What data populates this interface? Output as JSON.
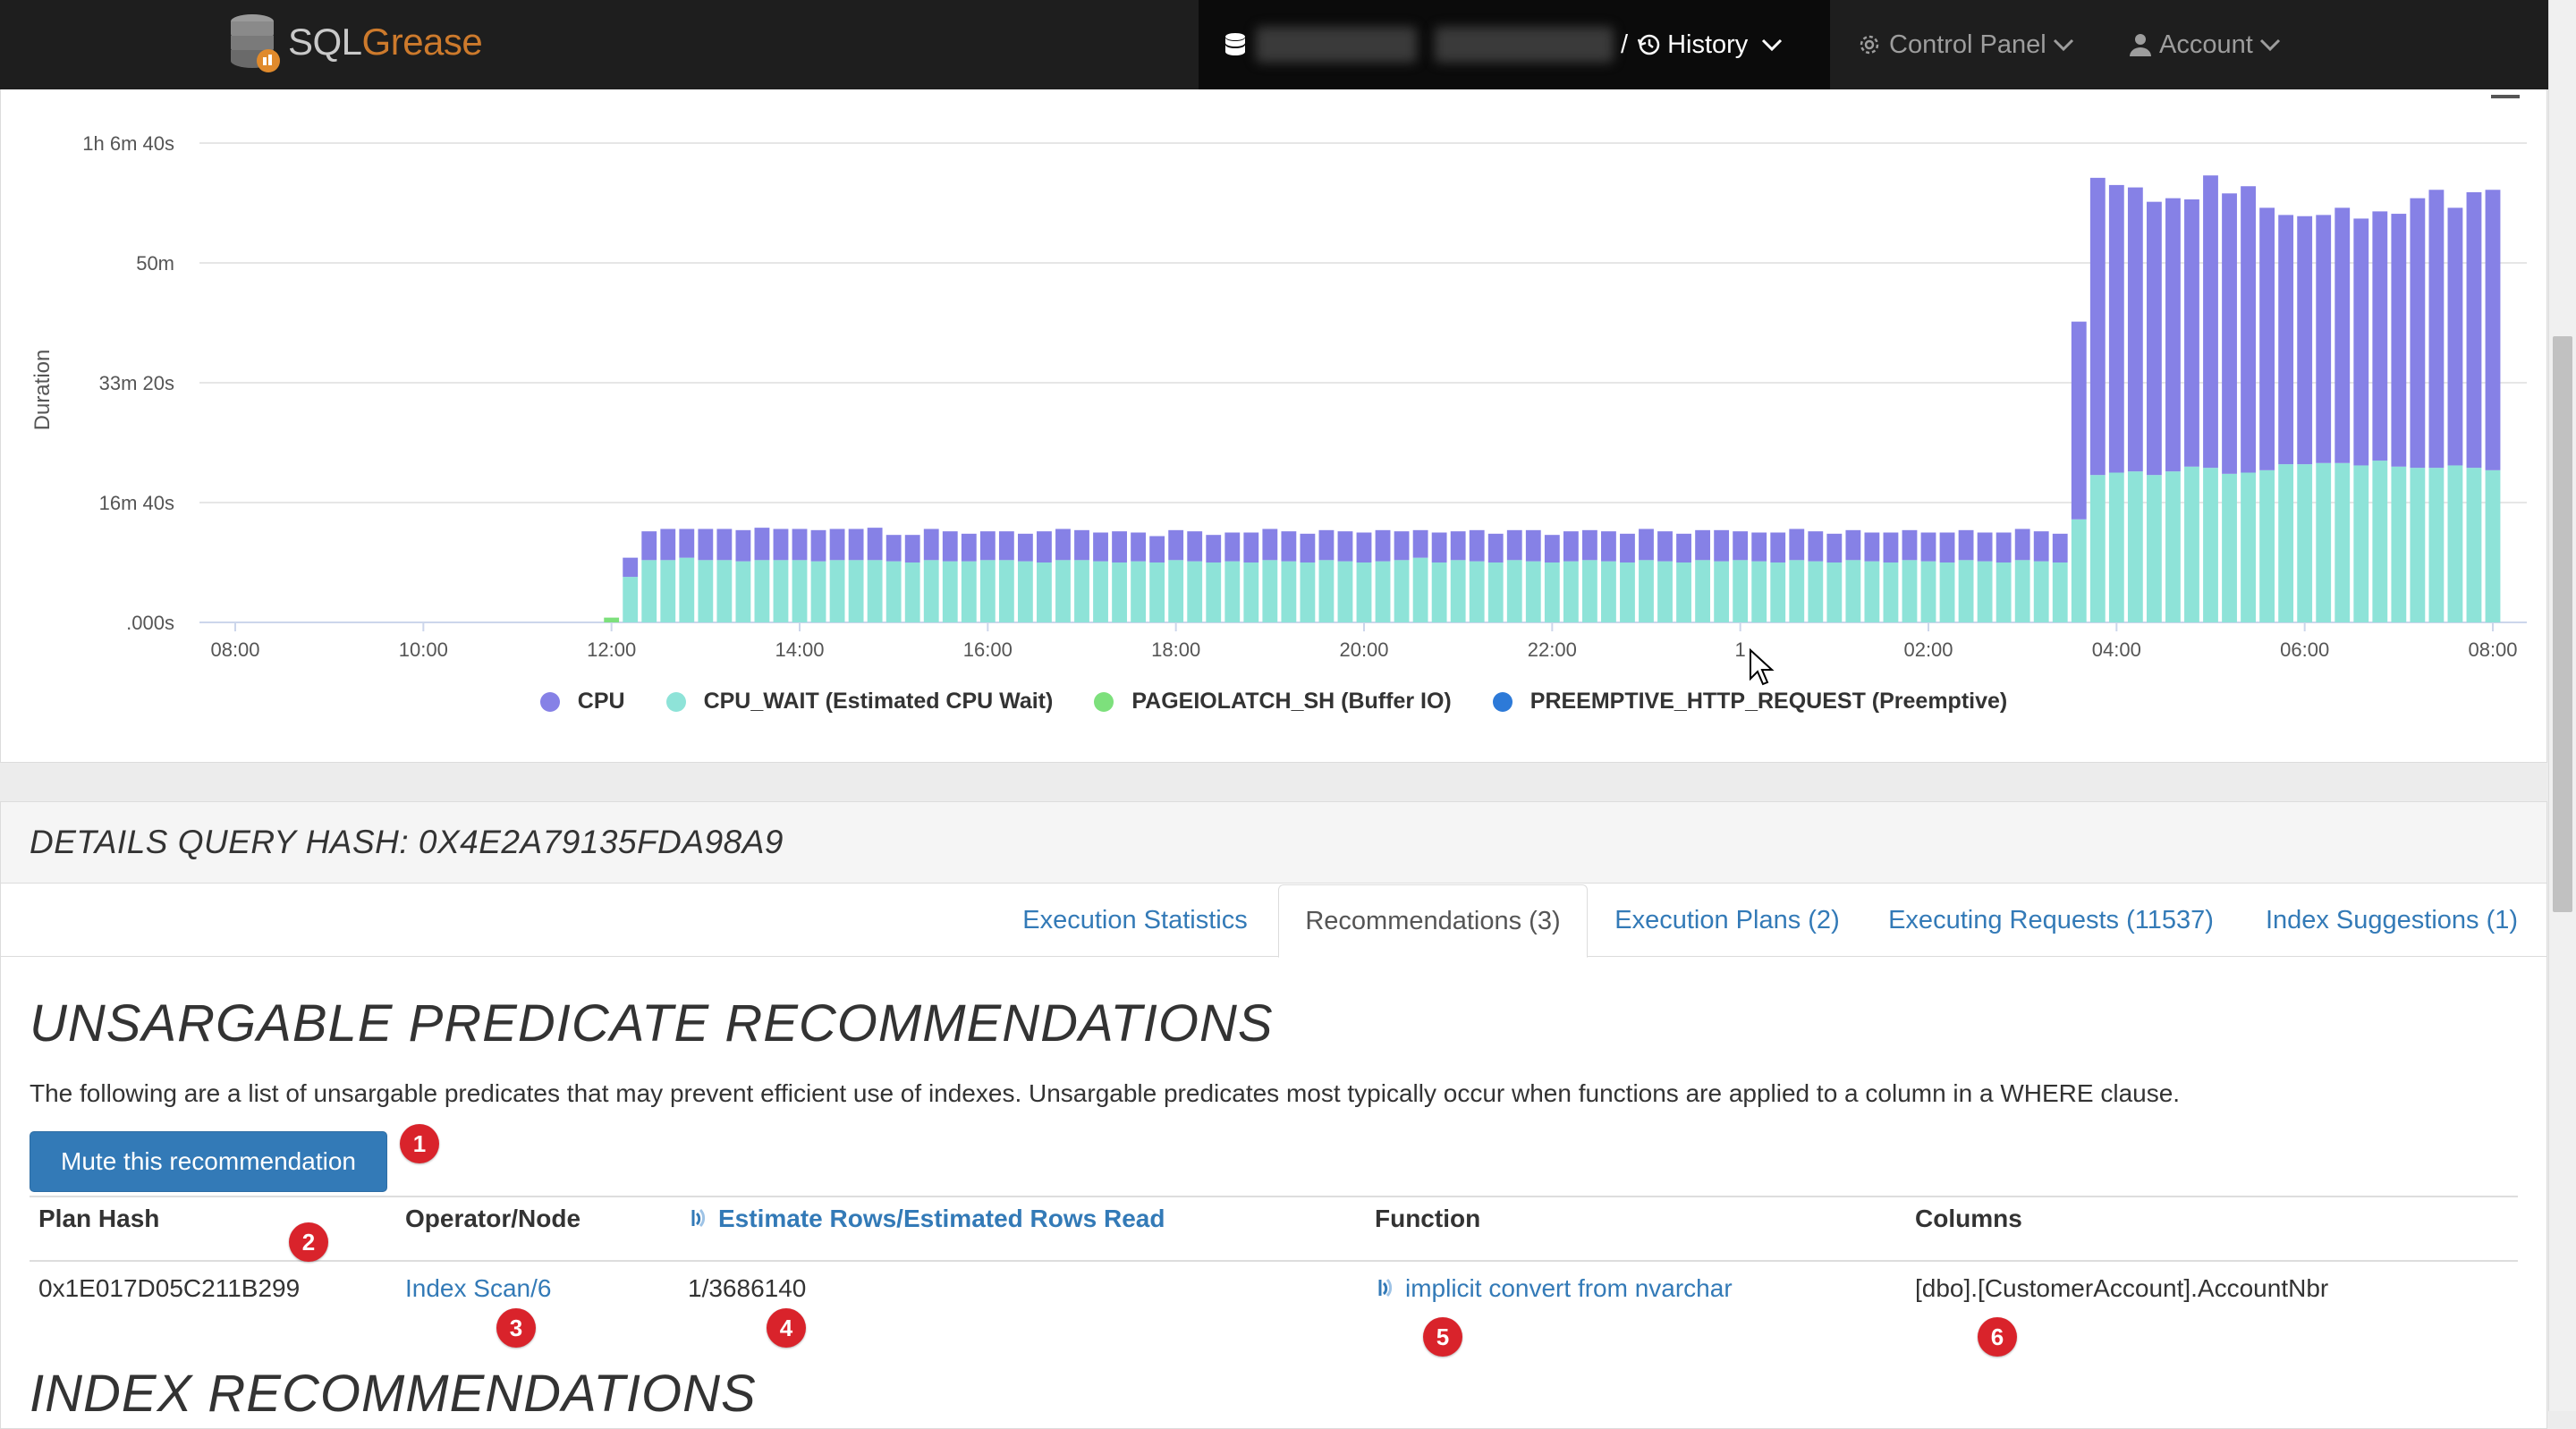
{
  "navbar": {
    "logo_sql": "SQL",
    "logo_grease": "Grease",
    "breadcrumb_sep": "/",
    "history_label": "History",
    "control_panel_label": "Control Panel",
    "account_label": "Account"
  },
  "chart_data": {
    "type": "bar",
    "ylabel": "Duration",
    "y_tick_labels": [
      ".000s",
      "16m 40s",
      "33m 20s",
      "50m",
      "1h 6m 40s"
    ],
    "y_tick_seconds": [
      0,
      1000,
      2000,
      3000,
      4000
    ],
    "ylim_seconds": [
      0,
      4000
    ],
    "x_tick_labels": [
      "08:00",
      "10:00",
      "12:00",
      "14:00",
      "16:00",
      "18:00",
      "20:00",
      "22:00",
      "1",
      "02:00",
      "04:00",
      "06:00",
      "08:00"
    ],
    "x_tick_hours": [
      0,
      2,
      4,
      6,
      8,
      10,
      12,
      14,
      16,
      18,
      20,
      22,
      24
    ],
    "bar_interval_hours": 0.2,
    "first_bar_hour": 4.0,
    "series": [
      {
        "name": "CPU",
        "color": "#8681e6",
        "values": [
          0,
          160,
          240,
          260,
          240,
          260,
          260,
          260,
          270,
          260,
          260,
          260,
          260,
          260,
          270,
          220,
          230,
          260,
          250,
          230,
          240,
          240,
          230,
          260,
          260,
          250,
          240,
          260,
          240,
          220,
          250,
          250,
          230,
          240,
          250,
          260,
          250,
          240,
          250,
          250,
          250,
          260,
          240,
          230,
          250,
          240,
          260,
          240,
          250,
          260,
          230,
          250,
          250,
          250,
          240,
          260,
          250,
          240,
          250,
          260,
          240,
          240,
          250,
          260,
          250,
          240,
          250,
          240,
          250,
          250,
          240,
          250,
          250,
          240,
          250,
          260,
          250,
          240,
          1650,
          2480,
          2400,
          2370,
          2280,
          2280,
          2230,
          2440,
          2340,
          2390,
          2190,
          2080,
          2070,
          2070,
          2130,
          2060,
          2080,
          2110,
          2250,
          2320,
          2150,
          2300,
          2340
        ]
      },
      {
        "name": "CPU_WAIT (Estimated CPU Wait)",
        "color": "#8ee3d8",
        "values": [
          0,
          380,
          520,
          520,
          540,
          520,
          520,
          510,
          520,
          520,
          520,
          510,
          520,
          520,
          520,
          510,
          500,
          520,
          510,
          510,
          520,
          520,
          510,
          500,
          520,
          520,
          510,
          500,
          510,
          500,
          520,
          510,
          500,
          510,
          500,
          520,
          510,
          500,
          520,
          510,
          500,
          510,
          520,
          540,
          500,
          520,
          510,
          500,
          520,
          510,
          500,
          510,
          520,
          510,
          500,
          520,
          510,
          500,
          520,
          510,
          520,
          510,
          500,
          520,
          510,
          500,
          520,
          510,
          500,
          520,
          510,
          500,
          520,
          510,
          500,
          520,
          510,
          500,
          860,
          1230,
          1250,
          1260,
          1230,
          1260,
          1300,
          1290,
          1240,
          1250,
          1270,
          1320,
          1320,
          1330,
          1330,
          1310,
          1350,
          1300,
          1290,
          1290,
          1310,
          1290,
          1270
        ]
      },
      {
        "name": "PAGEIOLATCH_SH (Buffer IO)",
        "color": "#7de07c",
        "values": [
          40,
          0,
          0,
          0,
          0,
          0,
          0,
          0,
          0,
          0,
          0,
          0,
          0,
          0,
          0,
          0,
          0,
          0,
          0,
          0,
          0,
          0,
          0,
          0,
          0,
          0,
          0,
          0,
          0,
          0,
          0,
          0,
          0,
          0,
          0,
          0,
          0,
          0,
          0,
          0,
          0,
          0,
          0,
          0,
          0,
          0,
          0,
          0,
          0,
          0,
          0,
          0,
          0,
          0,
          0,
          0,
          0,
          0,
          0,
          0,
          0,
          0,
          0,
          0,
          0,
          0,
          0,
          0,
          0,
          0,
          0,
          0,
          0,
          0,
          0,
          0,
          0,
          0,
          0,
          0,
          0,
          0,
          0,
          0,
          0,
          0,
          0,
          0,
          0,
          0,
          0,
          0,
          0,
          0,
          0,
          0,
          0,
          0,
          0,
          0,
          0
        ]
      },
      {
        "name": "PREEMPTIVE_HTTP_REQUEST (Preemptive)",
        "color": "#2d7ad8",
        "values": []
      }
    ]
  },
  "details": {
    "header": "DETAILS QUERY HASH: 0X4E2A79135FDA98A9",
    "tabs": [
      {
        "label": "Execution Statistics"
      },
      {
        "label": "Recommendations (3)"
      },
      {
        "label": "Execution Plans (2)"
      },
      {
        "label": "Executing Requests (11537)"
      },
      {
        "label": "Index Suggestions (1)"
      }
    ],
    "section_title": "UNSARGABLE PREDICATE RECOMMENDATIONS",
    "section_desc": "The following are a list of unsargable predicates that may prevent efficient use of indexes. Unsargable predicates most typically occur when functions are applied to a column in a WHERE clause.",
    "mute_button": "Mute this recommendation",
    "table": {
      "headers": [
        "Plan Hash",
        "Operator/Node",
        "Estimate Rows/Estimated Rows Read",
        "Function",
        "Columns"
      ],
      "row": [
        "0x1E017D05C211B299",
        "Index Scan/6",
        "1/3686140",
        "implicit convert from nvarchar",
        "[dbo].[CustomerAccount].AccountNbr"
      ]
    },
    "badges": [
      "1",
      "2",
      "3",
      "4",
      "5",
      "6"
    ],
    "next_section_title": "INDEX RECOMMENDATIONS"
  }
}
